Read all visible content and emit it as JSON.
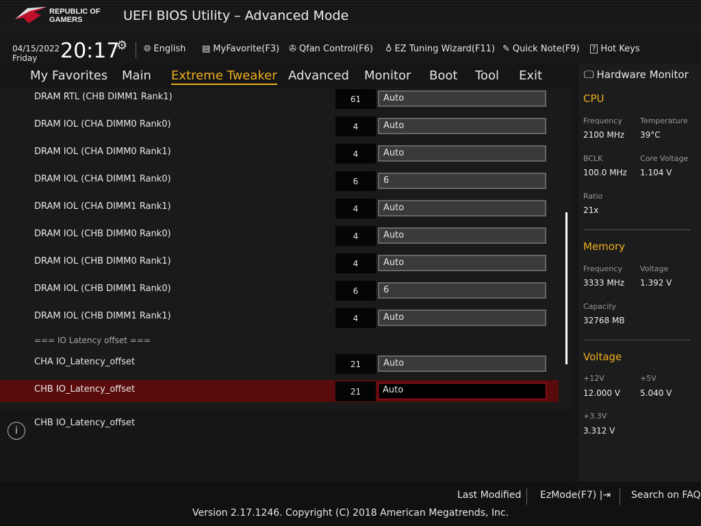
{
  "header": {
    "brand_line1": "REPUBLIC OF",
    "brand_line2": "GAMERS",
    "title": "UEFI BIOS Utility – Advanced Mode"
  },
  "toolbar": {
    "date": "04/15/2022",
    "day": "Friday",
    "time": "20:17",
    "language": "English",
    "myfavorite": "MyFavorite(F3)",
    "qfan": "Qfan Control(F6)",
    "ez_tuning": "EZ Tuning Wizard(F11)",
    "quick_note": "Quick Note(F9)",
    "hot_keys": "Hot Keys"
  },
  "tabs": [
    "My Favorites",
    "Main",
    "Extreme Tweaker",
    "Advanced",
    "Monitor",
    "Boot",
    "Tool",
    "Exit"
  ],
  "active_tab": "Extreme Tweaker",
  "rows": [
    {
      "label": "DRAM RTL (CHB DIMM1 Rank1)",
      "num": "61",
      "value": "Auto"
    },
    {
      "label": "DRAM IOL (CHA DIMM0 Rank0)",
      "num": "4",
      "value": "Auto"
    },
    {
      "label": "DRAM IOL (CHA DIMM0 Rank1)",
      "num": "4",
      "value": "Auto"
    },
    {
      "label": "DRAM IOL (CHA DIMM1 Rank0)",
      "num": "6",
      "value": "6"
    },
    {
      "label": "DRAM IOL (CHA DIMM1 Rank1)",
      "num": "4",
      "value": "Auto"
    },
    {
      "label": "DRAM IOL (CHB DIMM0 Rank0)",
      "num": "4",
      "value": "Auto"
    },
    {
      "label": "DRAM IOL (CHB DIMM0 Rank1)",
      "num": "4",
      "value": "Auto"
    },
    {
      "label": "DRAM IOL (CHB DIMM1 Rank0)",
      "num": "6",
      "value": "6"
    },
    {
      "label": "DRAM IOL (CHB DIMM1 Rank1)",
      "num": "4",
      "value": "Auto"
    }
  ],
  "section": "=== IO Latency offset ===",
  "rows2": [
    {
      "label": "CHA IO_Latency_offset",
      "num": "21",
      "value": "Auto"
    },
    {
      "label": "CHB IO_Latency_offset",
      "num": "21",
      "value": "Auto"
    }
  ],
  "help": "CHB IO_Latency_offset",
  "hw": {
    "title": "Hardware Monitor",
    "cpu": {
      "title": "CPU",
      "freq_l": "Frequency",
      "freq": "2100 MHz",
      "temp_l": "Temperature",
      "temp": "39°C",
      "bclk_l": "BCLK",
      "bclk": "100.0 MHz",
      "cv_l": "Core Voltage",
      "cv": "1.104 V",
      "ratio_l": "Ratio",
      "ratio": "21x"
    },
    "mem": {
      "title": "Memory",
      "freq_l": "Frequency",
      "freq": "3333 MHz",
      "volt_l": "Voltage",
      "volt": "1.392 V",
      "cap_l": "Capacity",
      "cap": "32768 MB"
    },
    "volt": {
      "title": "Voltage",
      "v12_l": "+12V",
      "v12": "12.000 V",
      "v5_l": "+5V",
      "v5": "5.040 V",
      "v33_l": "+3.3V",
      "v33": "3.312 V"
    }
  },
  "footer": {
    "last_modified": "Last Modified",
    "ezmode": "EzMode(F7)",
    "search": "Search on FAQ",
    "copyright": "Version 2.17.1246. Copyright (C) 2018 American Megatrends, Inc."
  },
  "colors": {
    "accent": "#f0b020",
    "selected_row": "#5a0c0c"
  }
}
